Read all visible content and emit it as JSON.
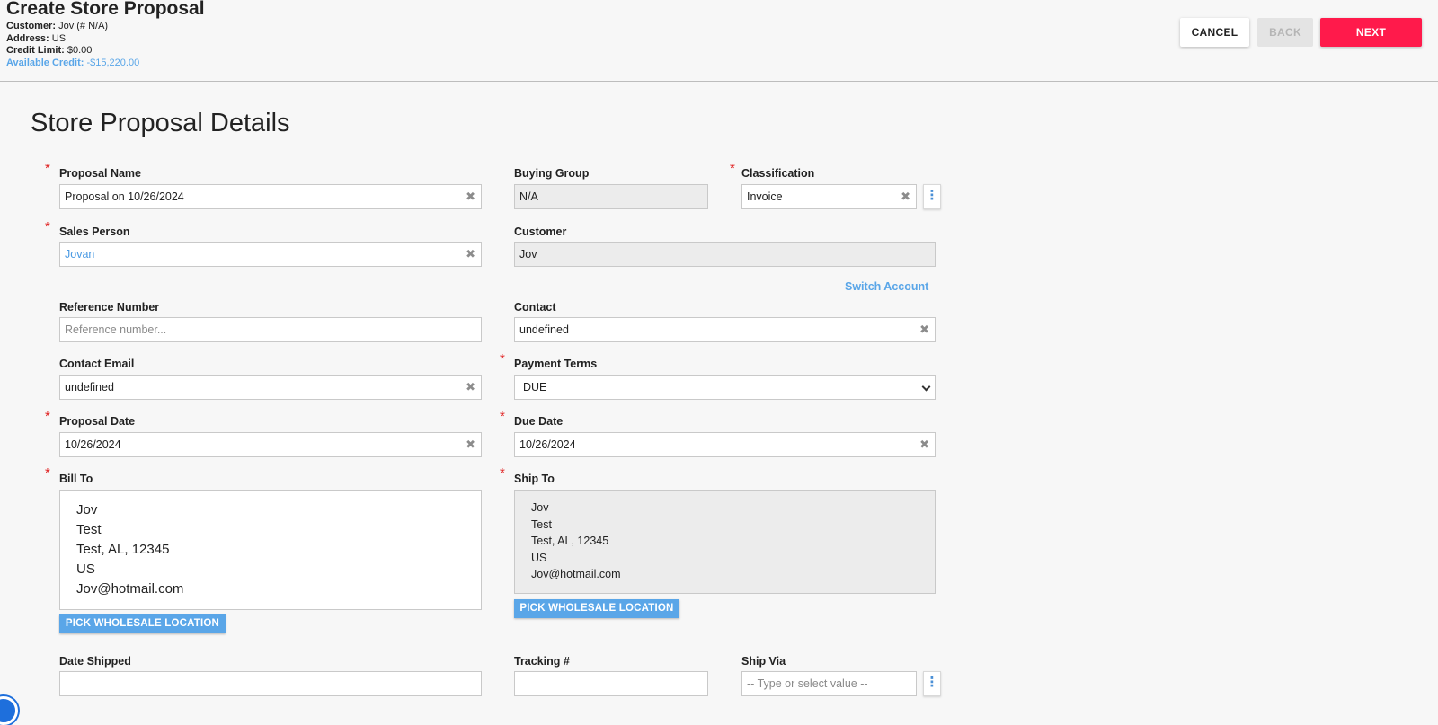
{
  "header": {
    "title": "Create Store Proposal",
    "customer_label": "Customer:",
    "customer_value": "Jov (# N/A)",
    "address_label": "Address:",
    "address_value": "US",
    "credit_limit_label": "Credit Limit:",
    "credit_limit_value": "$0.00",
    "available_credit_label": "Available Credit:",
    "available_credit_value": "-$15,220.00",
    "buttons": {
      "cancel": "CANCEL",
      "back": "BACK",
      "next": "NEXT"
    }
  },
  "section_title": "Store Proposal Details",
  "form": {
    "proposal_name": {
      "label": "Proposal Name",
      "value": "Proposal on 10/26/2024"
    },
    "buying_group": {
      "label": "Buying Group",
      "value": "N/A"
    },
    "classification": {
      "label": "Classification",
      "value": "Invoice"
    },
    "sales_person": {
      "label": "Sales Person",
      "value": "Jovan"
    },
    "customer": {
      "label": "Customer",
      "value": "Jov"
    },
    "switch_account": "Switch Account",
    "reference_number": {
      "label": "Reference Number",
      "placeholder": "Reference number..."
    },
    "contact": {
      "label": "Contact",
      "value": "undefined"
    },
    "contact_email": {
      "label": "Contact Email",
      "value": "undefined"
    },
    "payment_terms": {
      "label": "Payment Terms",
      "value": "DUE"
    },
    "proposal_date": {
      "label": "Proposal Date",
      "value": "10/26/2024"
    },
    "due_date": {
      "label": "Due Date",
      "value": "10/26/2024"
    },
    "bill_to": {
      "label": "Bill To",
      "lines": [
        "Jov",
        "Test",
        "Test, AL, 12345",
        "US",
        "Jov@hotmail.com"
      ]
    },
    "ship_to": {
      "label": "Ship To",
      "lines": [
        "Jov",
        "Test",
        "Test, AL, 12345",
        "US",
        "Jov@hotmail.com"
      ]
    },
    "pick_wholesale_label": "PICK WHOLESALE LOCATION",
    "date_shipped": {
      "label": "Date Shipped",
      "value": ""
    },
    "tracking": {
      "label": "Tracking #",
      "value": ""
    },
    "ship_via": {
      "label": "Ship Via",
      "placeholder": "-- Type or select value --"
    }
  },
  "icons": {
    "clear": "✖",
    "kebab": "⋮"
  },
  "colors": {
    "primary_action": "#ff1a4b",
    "link_blue": "#5aa6e8",
    "required_star": "#e02020"
  }
}
